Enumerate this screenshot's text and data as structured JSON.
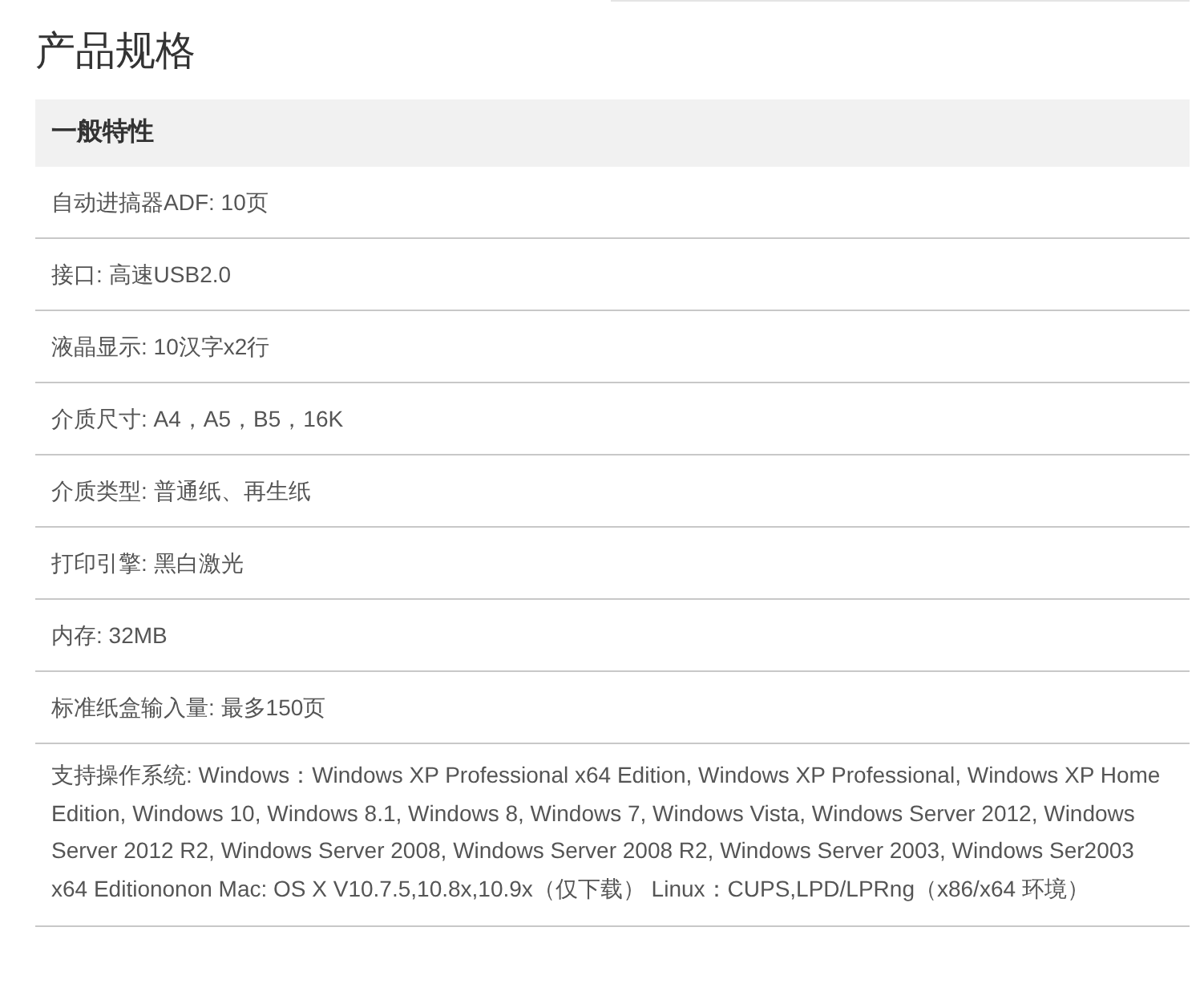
{
  "title": "产品规格",
  "section": {
    "heading": "一般特性",
    "rows": [
      "自动进搞器ADF: 10页",
      "接口: 高速USB2.0",
      "液晶显示: 10汉字x2行",
      "介质尺寸: A4，A5，B5，16K",
      "介质类型: 普通纸、再生纸",
      "打印引擎: 黑白激光",
      "内存: 32MB",
      "标准纸盒输入量: 最多150页",
      "支持操作系统: Windows：Windows XP Professional x64 Edition, Windows XP Professional, Windows XP Home Edition, Windows 10, Windows 8.1, Windows 8, Windows 7, Windows Vista, Windows Server 2012, Windows Server 2012 R2, Windows Server 2008, Windows Server 2008 R2, Windows Server 2003, Windows Ser2003 x64 Editiononon Mac: OS X V10.7.5,10.8x,10.9x（仅下载） Linux：CUPS,LPD/LPRng（x86/x64 环境）"
    ]
  }
}
